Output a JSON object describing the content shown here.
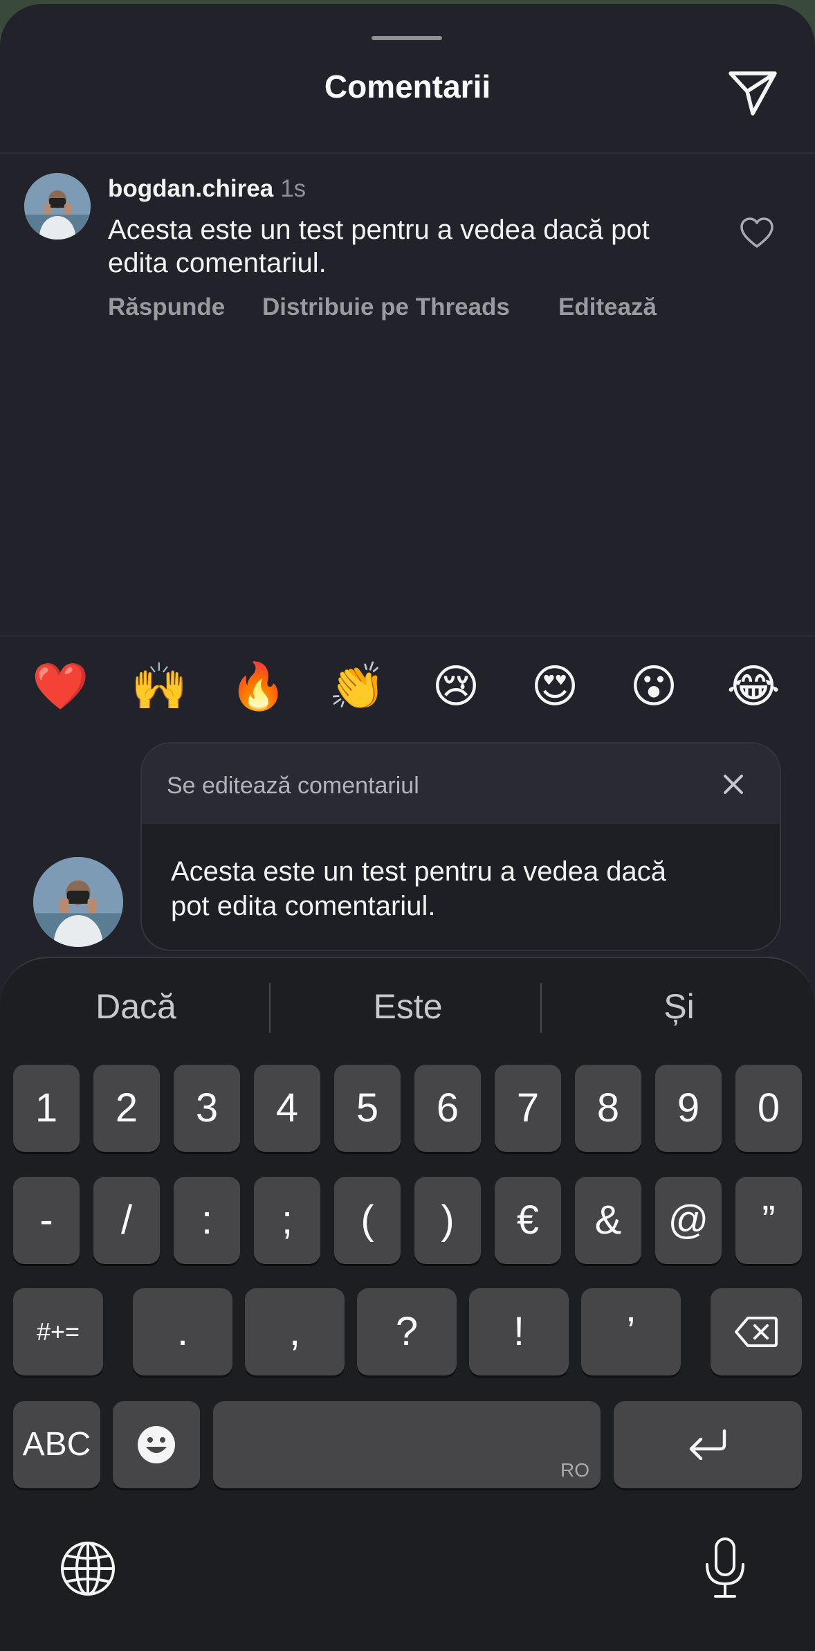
{
  "header": {
    "title": "Comentarii"
  },
  "comment": {
    "username": "bogdan.chirea",
    "time": "1s",
    "text": "Acesta este un test pentru a vedea dacă pot edita comentariul.",
    "actions": {
      "reply": "Răspunde",
      "share": "Distribuie pe Threads",
      "edit": "Editează"
    }
  },
  "emojis": [
    "❤️",
    "🙌",
    "🔥",
    "👏",
    "😢",
    "😍",
    "😮",
    "😂"
  ],
  "editing": {
    "label": "Se editează comentariul",
    "text": "Acesta este un test pentru a vedea dacă pot edita comentariul."
  },
  "keyboard": {
    "suggestions": [
      "Dacă",
      "Este",
      "Și"
    ],
    "row1": [
      "1",
      "2",
      "3",
      "4",
      "5",
      "6",
      "7",
      "8",
      "9",
      "0"
    ],
    "row2": [
      "-",
      "/",
      ":",
      ";",
      "(",
      ")",
      "€",
      "&",
      "@",
      "”"
    ],
    "row3": {
      "shift": "#+=",
      "keys": [
        ".",
        ",",
        "?",
        "!",
        "’"
      ]
    },
    "abc": "ABC",
    "space_lang": "RO"
  },
  "colors": {
    "sheet": "#22232a",
    "keyboard": "#1d1e21",
    "key": "#464649"
  }
}
